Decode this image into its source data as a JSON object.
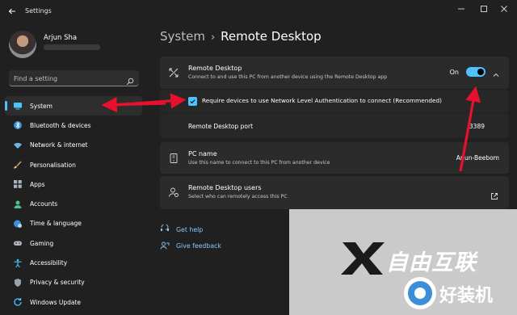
{
  "window": {
    "title": "Settings"
  },
  "user": {
    "name": "Arjun Sha"
  },
  "search": {
    "placeholder": "Find a setting"
  },
  "sidebar": {
    "items": [
      {
        "label": "System",
        "icon": "monitor-icon",
        "active": true
      },
      {
        "label": "Bluetooth & devices",
        "icon": "bluetooth-icon"
      },
      {
        "label": "Network & internet",
        "icon": "wifi-icon"
      },
      {
        "label": "Personalisation",
        "icon": "brush-icon"
      },
      {
        "label": "Apps",
        "icon": "apps-icon"
      },
      {
        "label": "Accounts",
        "icon": "person-icon"
      },
      {
        "label": "Time & language",
        "icon": "globe-clock-icon"
      },
      {
        "label": "Gaming",
        "icon": "gamepad-icon"
      },
      {
        "label": "Accessibility",
        "icon": "accessibility-icon"
      },
      {
        "label": "Privacy & security",
        "icon": "shield-icon"
      },
      {
        "label": "Windows Update",
        "icon": "update-icon"
      }
    ]
  },
  "breadcrumb": {
    "parent": "System",
    "separator": "›",
    "current": "Remote Desktop"
  },
  "remote_desktop": {
    "title": "Remote Desktop",
    "description": "Connect to and use this PC from another device using the Remote Desktop app",
    "toggle_label": "On",
    "toggle_on": true,
    "nla_label": "Require devices to use Network Level Authentication to connect (Recommended)",
    "nla_checked": true,
    "port_label": "Remote Desktop port",
    "port_value": "3389"
  },
  "pc_name": {
    "title": "PC name",
    "description": "Use this name to connect to this PC from another device",
    "value": "Arjun-Beebom"
  },
  "users": {
    "title": "Remote Desktop users",
    "description": "Select who can remotely access this PC"
  },
  "links": {
    "help": "Get help",
    "feedback": "Give feedback"
  },
  "watermark": {
    "line1": "自由互联",
    "line2": "好装机"
  },
  "colors": {
    "accent": "#4cc2ff",
    "arrow": "#e8112d",
    "background": "#202020",
    "card": "#2b2b2b"
  }
}
